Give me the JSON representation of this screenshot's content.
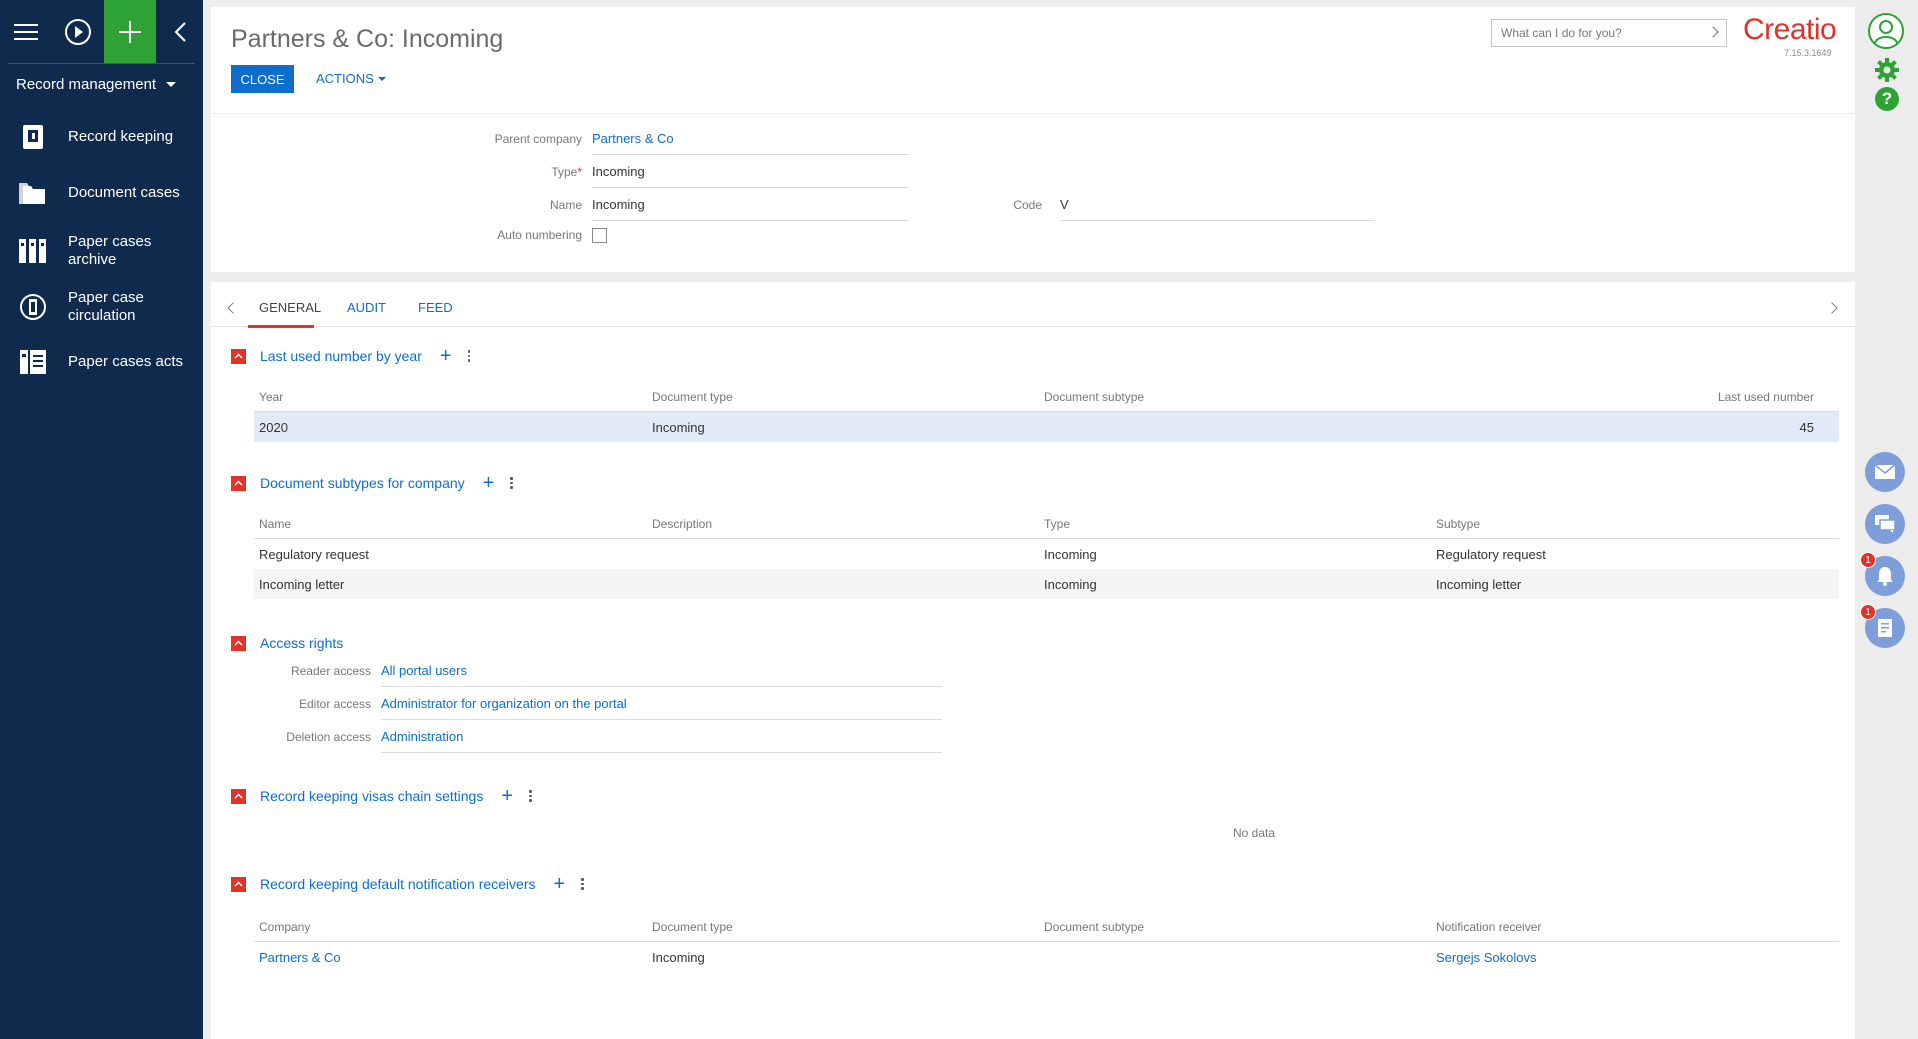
{
  "sidebar": {
    "section": "Record management",
    "items": [
      {
        "label": "Record keeping"
      },
      {
        "label": "Document cases"
      },
      {
        "label": "Paper cases archive"
      },
      {
        "label": "Paper case circulation"
      },
      {
        "label": "Paper cases acts"
      }
    ]
  },
  "header": {
    "title": "Partners & Co: Incoming",
    "close_label": "CLOSE",
    "actions_label": "ACTIONS",
    "search_placeholder": "What can I do for you?",
    "logo": "Creatio",
    "version": "7.15.3.1649"
  },
  "form": {
    "parent_company": {
      "label": "Parent company",
      "value": "Partners & Co"
    },
    "type": {
      "label": "Type",
      "required": "*",
      "value": "Incoming"
    },
    "name": {
      "label": "Name",
      "value": "Incoming"
    },
    "code": {
      "label": "Code",
      "value": "V"
    },
    "auto_numbering": {
      "label": "Auto numbering",
      "checked": false
    }
  },
  "tabs": [
    {
      "label": "GENERAL",
      "active": true
    },
    {
      "label": "AUDIT"
    },
    {
      "label": "FEED"
    }
  ],
  "sections": {
    "last_used": {
      "title": "Last used number by year",
      "columns": [
        "Year",
        "Document type",
        "Document subtype",
        "Last used number"
      ],
      "rows": [
        {
          "year": "2020",
          "doc_type": "Incoming",
          "doc_subtype": "",
          "number": "45"
        }
      ]
    },
    "subtypes": {
      "title": "Document subtypes for company",
      "columns": [
        "Name",
        "Description",
        "Type",
        "Subtype"
      ],
      "rows": [
        {
          "name": "Regulatory request",
          "description": "",
          "type": "Incoming",
          "subtype": "Regulatory request"
        },
        {
          "name": "Incoming letter",
          "description": "",
          "type": "Incoming",
          "subtype": "Incoming letter"
        }
      ]
    },
    "access": {
      "title": "Access rights",
      "reader": {
        "label": "Reader access",
        "value": "All portal users"
      },
      "editor": {
        "label": "Editor access",
        "value": "Administrator for organization on the portal"
      },
      "deletion": {
        "label": "Deletion access",
        "value": "Administration"
      }
    },
    "visas": {
      "title": "Record keeping visas chain settings",
      "empty": "No data"
    },
    "receivers": {
      "title": "Record keeping default notification receivers",
      "columns": [
        "Company",
        "Document type",
        "Document subtype",
        "Notification receiver"
      ],
      "rows": [
        {
          "company": "Partners & Co",
          "doc_type": "Incoming",
          "doc_subtype": "",
          "receiver": "Sergejs Sokolovs"
        }
      ]
    }
  },
  "right_panel": {
    "notifications_badge": "1",
    "tasks_badge": "1"
  },
  "colors": {
    "sidebar_bg": "#0f2a4d",
    "accent_blue": "#0e6dcd",
    "accent_red": "#e2322a",
    "accent_green": "#2ea234"
  }
}
